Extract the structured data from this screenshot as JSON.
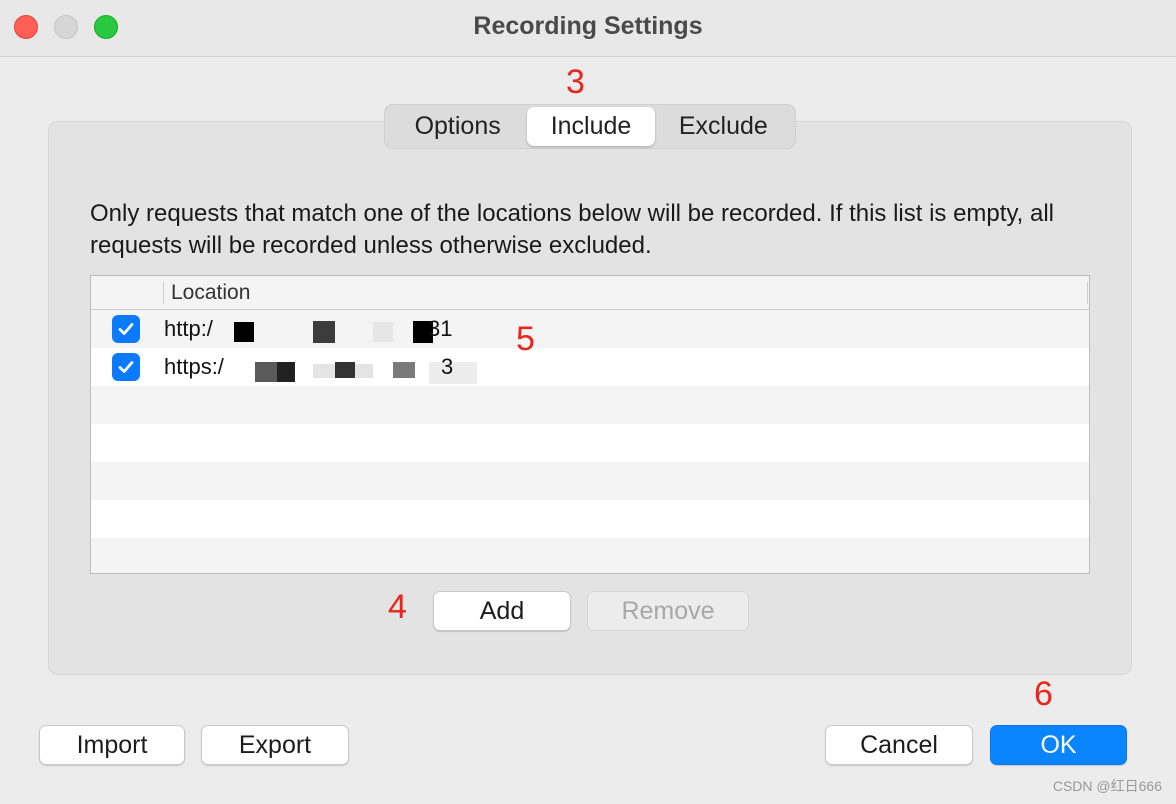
{
  "window": {
    "title": "Recording Settings"
  },
  "annotations": {
    "a3": "3",
    "a4": "4",
    "a5": "5",
    "a6": "6"
  },
  "tabs": [
    {
      "label": "Options",
      "selected": false
    },
    {
      "label": "Include",
      "selected": true
    },
    {
      "label": "Exclude",
      "selected": false
    }
  ],
  "include": {
    "description": "Only requests that match one of the locations below will be recorded. If this list is empty, all requests will be recorded unless otherwise excluded.",
    "table": {
      "column_location": "Location",
      "rows": [
        {
          "checked": true,
          "prefix": "http:/",
          "suffix": "31"
        },
        {
          "checked": true,
          "prefix": "https:/",
          "suffix": "3"
        }
      ]
    },
    "add_label": "Add",
    "remove_label": "Remove"
  },
  "footer": {
    "import_label": "Import",
    "export_label": "Export",
    "cancel_label": "Cancel",
    "ok_label": "OK"
  },
  "watermark": "CSDN @红日666",
  "colors": {
    "accent": "#0a84ff",
    "annotation": "#e8261b"
  }
}
